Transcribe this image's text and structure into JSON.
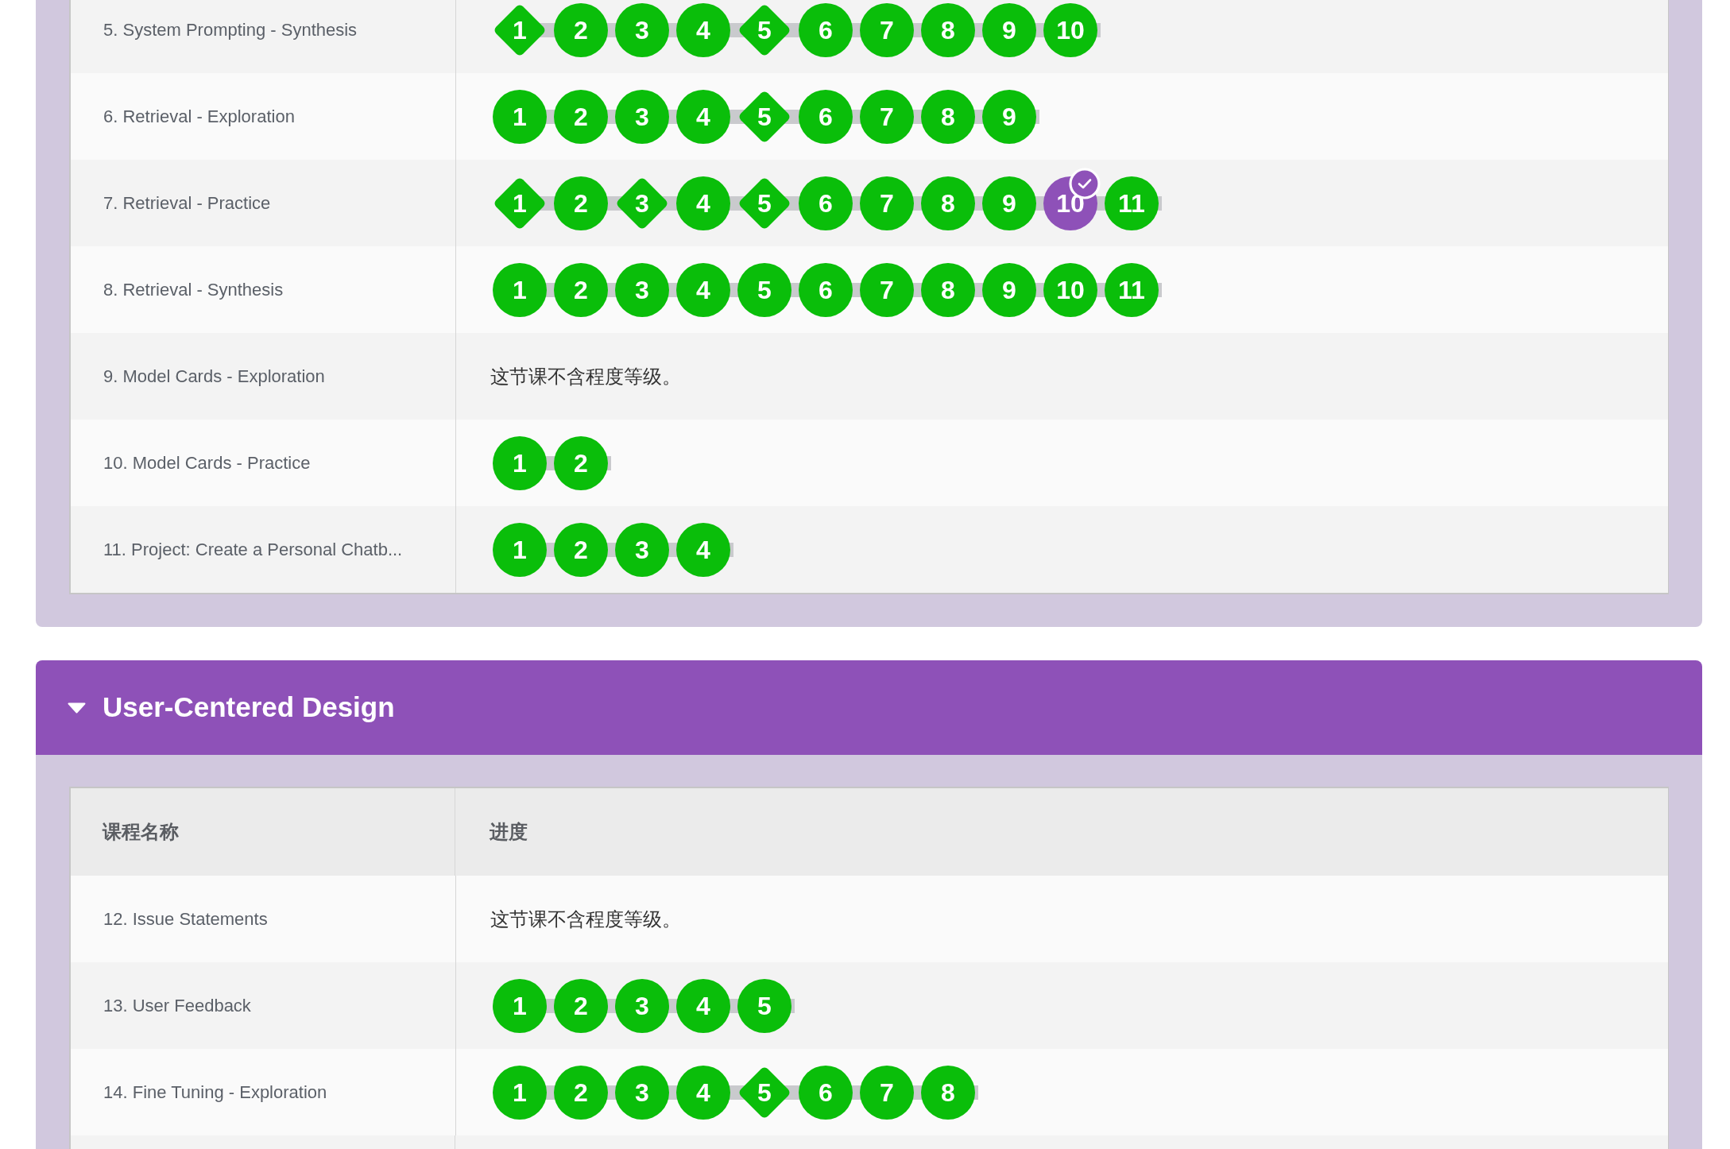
{
  "sections": [
    {
      "rows": [
        {
          "name": "5. System Prompting - Synthesis",
          "levels": [
            {
              "label": "1",
              "kind": "diamond",
              "selected": false
            },
            {
              "label": "2",
              "kind": "circle",
              "selected": false
            },
            {
              "label": "3",
              "kind": "circle",
              "selected": false
            },
            {
              "label": "4",
              "kind": "circle",
              "selected": false
            },
            {
              "label": "5",
              "kind": "diamond",
              "selected": false
            },
            {
              "label": "6",
              "kind": "circle",
              "selected": false
            },
            {
              "label": "7",
              "kind": "circle",
              "selected": false
            },
            {
              "label": "8",
              "kind": "circle",
              "selected": false
            },
            {
              "label": "9",
              "kind": "circle",
              "selected": false
            },
            {
              "label": "10",
              "kind": "circle",
              "selected": false
            }
          ]
        },
        {
          "name": "6. Retrieval - Exploration",
          "levels": [
            {
              "label": "1",
              "kind": "circle",
              "selected": false
            },
            {
              "label": "2",
              "kind": "circle",
              "selected": false
            },
            {
              "label": "3",
              "kind": "circle",
              "selected": false
            },
            {
              "label": "4",
              "kind": "circle",
              "selected": false
            },
            {
              "label": "5",
              "kind": "diamond",
              "selected": false
            },
            {
              "label": "6",
              "kind": "circle",
              "selected": false
            },
            {
              "label": "7",
              "kind": "circle",
              "selected": false
            },
            {
              "label": "8",
              "kind": "circle",
              "selected": false
            },
            {
              "label": "9",
              "kind": "circle",
              "selected": false
            }
          ]
        },
        {
          "name": "7. Retrieval - Practice",
          "levels": [
            {
              "label": "1",
              "kind": "diamond",
              "selected": false
            },
            {
              "label": "2",
              "kind": "circle",
              "selected": false
            },
            {
              "label": "3",
              "kind": "diamond",
              "selected": false
            },
            {
              "label": "4",
              "kind": "circle",
              "selected": false
            },
            {
              "label": "5",
              "kind": "diamond",
              "selected": false
            },
            {
              "label": "6",
              "kind": "circle",
              "selected": false
            },
            {
              "label": "7",
              "kind": "circle",
              "selected": false
            },
            {
              "label": "8",
              "kind": "circle",
              "selected": false
            },
            {
              "label": "9",
              "kind": "circle",
              "selected": false
            },
            {
              "label": "10",
              "kind": "circle",
              "selected": true
            },
            {
              "label": "11",
              "kind": "circle",
              "selected": false
            }
          ]
        },
        {
          "name": "8. Retrieval - Synthesis",
          "levels": [
            {
              "label": "1",
              "kind": "circle",
              "selected": false
            },
            {
              "label": "2",
              "kind": "circle",
              "selected": false
            },
            {
              "label": "3",
              "kind": "circle",
              "selected": false
            },
            {
              "label": "4",
              "kind": "circle",
              "selected": false
            },
            {
              "label": "5",
              "kind": "circle",
              "selected": false
            },
            {
              "label": "6",
              "kind": "circle",
              "selected": false
            },
            {
              "label": "7",
              "kind": "circle",
              "selected": false
            },
            {
              "label": "8",
              "kind": "circle",
              "selected": false
            },
            {
              "label": "9",
              "kind": "circle",
              "selected": false
            },
            {
              "label": "10",
              "kind": "circle",
              "selected": false
            },
            {
              "label": "11",
              "kind": "circle",
              "selected": false
            }
          ]
        },
        {
          "name": "9. Model Cards - Exploration",
          "note": "这节课不含程度等级。"
        },
        {
          "name": "10. Model Cards - Practice",
          "levels": [
            {
              "label": "1",
              "kind": "circle",
              "selected": false
            },
            {
              "label": "2",
              "kind": "circle",
              "selected": false
            }
          ]
        },
        {
          "name": "11. Project: Create a Personal Chatb...",
          "levels": [
            {
              "label": "1",
              "kind": "circle",
              "selected": false
            },
            {
              "label": "2",
              "kind": "circle",
              "selected": false
            },
            {
              "label": "3",
              "kind": "circle",
              "selected": false
            },
            {
              "label": "4",
              "kind": "circle",
              "selected": false
            }
          ]
        }
      ]
    },
    {
      "title": "User-Centered Design",
      "expanded": true,
      "columns": [
        "课程名称",
        "进度"
      ],
      "rows": [
        {
          "name": "12. Issue Statements",
          "note": "这节课不含程度等级。"
        },
        {
          "name": "13. User Feedback",
          "levels": [
            {
              "label": "1",
              "kind": "circle",
              "selected": false
            },
            {
              "label": "2",
              "kind": "circle",
              "selected": false
            },
            {
              "label": "3",
              "kind": "circle",
              "selected": false
            },
            {
              "label": "4",
              "kind": "circle",
              "selected": false
            },
            {
              "label": "5",
              "kind": "circle",
              "selected": false
            }
          ]
        },
        {
          "name": "14. Fine Tuning - Exploration",
          "levels": [
            {
              "label": "1",
              "kind": "circle",
              "selected": false
            },
            {
              "label": "2",
              "kind": "circle",
              "selected": false
            },
            {
              "label": "3",
              "kind": "circle",
              "selected": false
            },
            {
              "label": "4",
              "kind": "circle",
              "selected": false
            },
            {
              "label": "5",
              "kind": "diamond",
              "selected": false
            },
            {
              "label": "6",
              "kind": "circle",
              "selected": false
            },
            {
              "label": "7",
              "kind": "circle",
              "selected": false
            },
            {
              "label": "8",
              "kind": "circle",
              "selected": false
            }
          ]
        }
      ]
    }
  ]
}
